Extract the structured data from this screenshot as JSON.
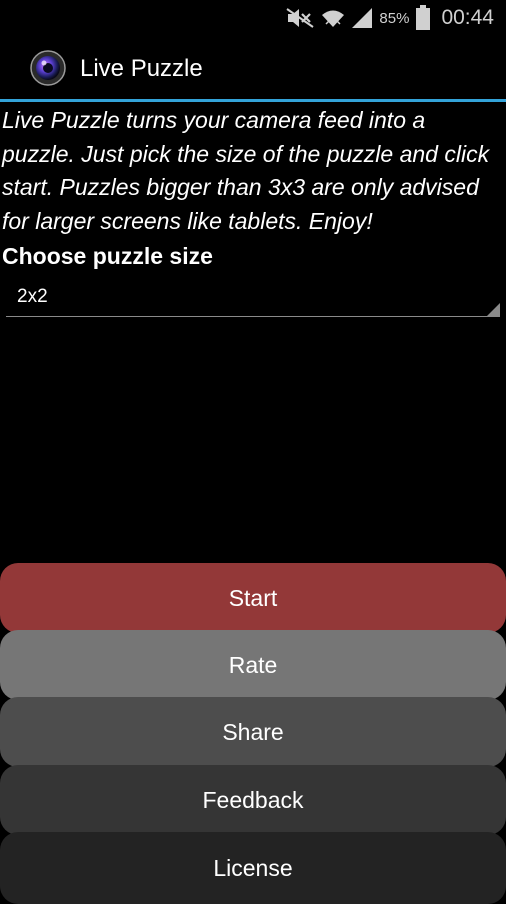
{
  "status_bar": {
    "battery_percent": "85%",
    "time": "00:44",
    "icons": [
      "mute-icon",
      "wifi-icon",
      "signal-icon",
      "battery-icon"
    ]
  },
  "action_bar": {
    "title": "Live Puzzle",
    "icon": "camera-lens-icon"
  },
  "main": {
    "description": "Live Puzzle turns your camera feed into a puzzle. Just pick the size of the puzzle and click start. Puzzles bigger than 3x3 are only advised for larger screens like tablets. Enjoy!",
    "choose_label": "Choose puzzle size",
    "puzzle_size": {
      "selected": "2x2"
    }
  },
  "buttons": {
    "start": "Start",
    "rate": "Rate",
    "share": "Share",
    "feedback": "Feedback",
    "license": "License"
  },
  "colors": {
    "accent": "#33a3d9",
    "start": "#933838",
    "rate": "#767676",
    "share": "#4d4d4d",
    "feedback": "#353535",
    "license": "#232323"
  }
}
